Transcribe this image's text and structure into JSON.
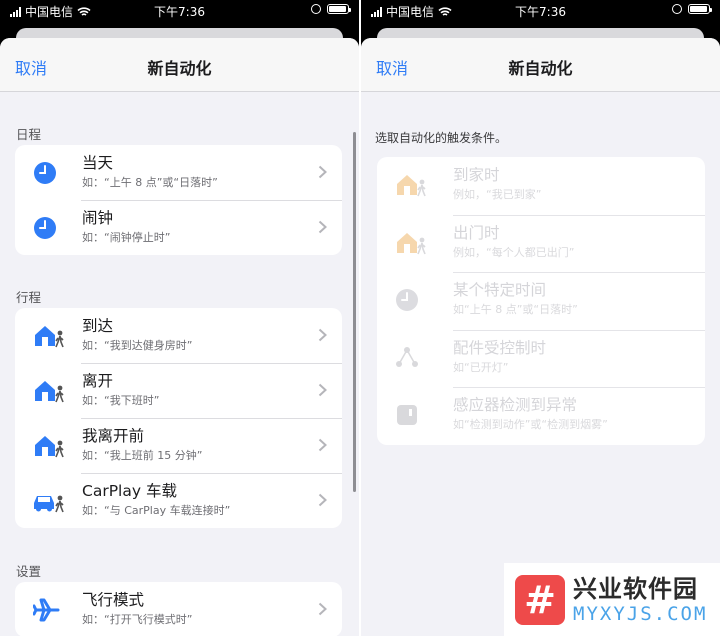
{
  "status_bar": {
    "carrier": "中国电信",
    "time": "下午7:36"
  },
  "left": {
    "nav": {
      "cancel": "取消",
      "title": "新自动化"
    },
    "sections": [
      {
        "label": "日程",
        "items": [
          {
            "title": "当天",
            "subtitle": "如：“上午 8 点”或“日落时”",
            "icon": "clock-icon"
          },
          {
            "title": "闹钟",
            "subtitle": "如：“闹钟停止时”",
            "icon": "clock-icon"
          }
        ]
      },
      {
        "label": "行程",
        "items": [
          {
            "title": "到达",
            "subtitle": "如：“我到达健身房时”",
            "icon": "home-person-icon"
          },
          {
            "title": "离开",
            "subtitle": "如：“我下班时”",
            "icon": "home-person-icon"
          },
          {
            "title": "我离开前",
            "subtitle": "如：“我上班前 15 分钟”",
            "icon": "home-person-icon"
          },
          {
            "title": "CarPlay 车载",
            "subtitle": "如：“与 CarPlay 车载连接时”",
            "icon": "car-person-icon"
          }
        ]
      },
      {
        "label": "设置",
        "items": [
          {
            "title": "飞行模式",
            "subtitle": "如：“打开飞行模式时”",
            "icon": "airplane-icon"
          }
        ]
      }
    ]
  },
  "right": {
    "nav": {
      "cancel": "取消",
      "title": "新自动化"
    },
    "prompt": "选取自动化的触发条件。",
    "items": [
      {
        "title": "到家时",
        "subtitle": "例如，“我已到家”",
        "icon": "home-person-icon"
      },
      {
        "title": "出门时",
        "subtitle": "例如，“每个人都已出门”",
        "icon": "home-person-icon"
      },
      {
        "title": "某个特定时间",
        "subtitle": "如“上午 8 点”或“日落时”",
        "icon": "clock-icon"
      },
      {
        "title": "配件受控制时",
        "subtitle": "如“已开灯”",
        "icon": "accessory-icon"
      },
      {
        "title": "感应器检测到异常",
        "subtitle": "如“检测到动作”或“检测到烟雾”",
        "icon": "sensor-icon"
      }
    ]
  },
  "watermark": {
    "logo_char": "#",
    "name": "兴业软件园",
    "site": "MYXYJS.COM"
  },
  "colors": {
    "accent": "#2f7cf6",
    "background": "#f2f2f7",
    "dim_icon": "#f6d7ad"
  }
}
